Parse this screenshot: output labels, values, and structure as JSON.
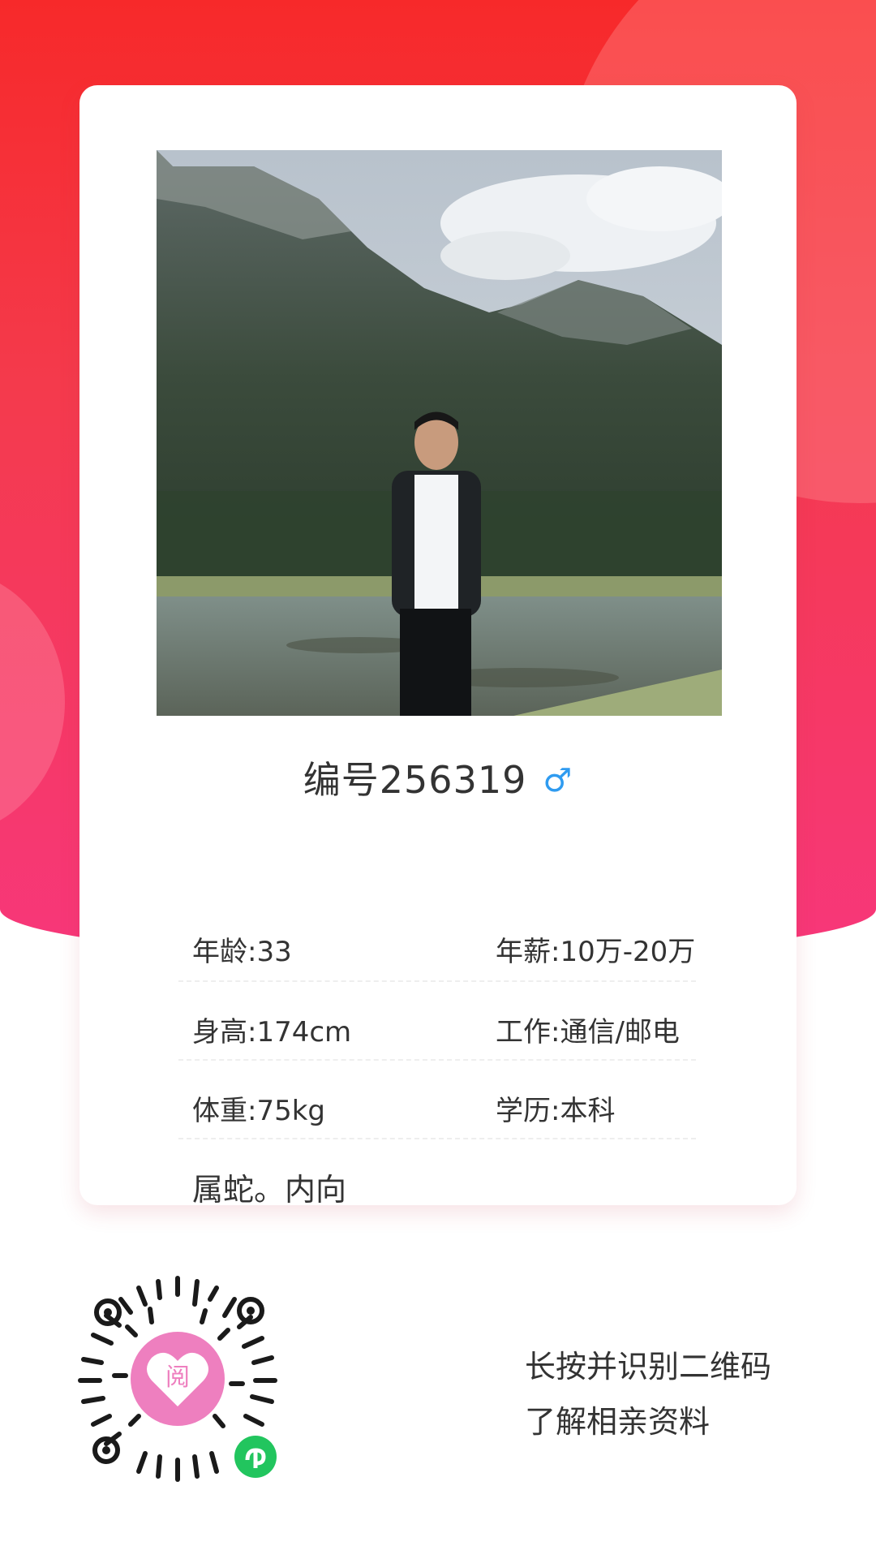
{
  "profile": {
    "title": "编号256319",
    "gender_icon": "male-symbol-icon",
    "gender_symbol": "♂",
    "rows": [
      {
        "left": "年龄:33",
        "right": "年薪:10万-20万"
      },
      {
        "left": "身高:174cm",
        "right": "工作:通信/邮电"
      },
      {
        "left": "体重:75kg",
        "right": "学历:本科"
      }
    ],
    "note": "属蛇。内向"
  },
  "footer": {
    "line1": "长按并识别二维码",
    "line2": "了解相亲资料"
  },
  "colors": {
    "brand_red": "#f7292a",
    "brand_pink": "#f7377a",
    "gender_blue": "#2f9bf0",
    "qr_center": "#ee7fbf",
    "mini_program_green": "#22c55e"
  }
}
